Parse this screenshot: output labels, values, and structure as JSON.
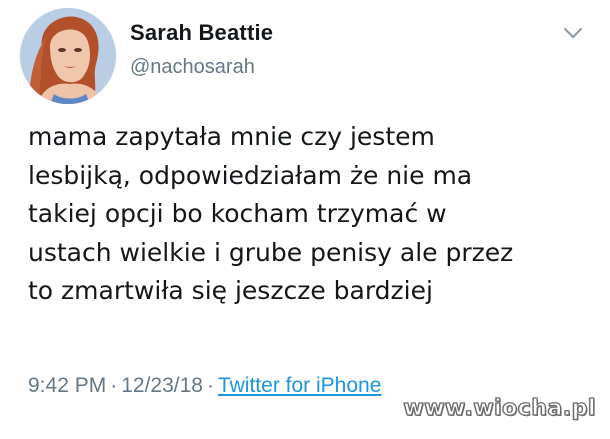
{
  "tweet": {
    "author": {
      "name": "Sarah Beattie",
      "handle": "@nachosarah"
    },
    "text_lines": [
      "mama zapytała mnie czy jestem",
      "lesbijką, odpowiedziałam że nie ma",
      "takiej opcji bo kocham trzymać w",
      "ustach wielkie i grube penisy ale przez",
      "to zmartwiła się jeszcze bardziej"
    ],
    "time": "9:42 PM",
    "separator": "·",
    "date": "12/23/18",
    "source": "Twitter for iPhone"
  },
  "icons": {
    "menu": "chevron-down-icon",
    "avatar": "avatar"
  },
  "watermark": "www.wiocha.pl",
  "colors": {
    "text": "#14171a",
    "secondary": "#657786",
    "link": "#1b95e0",
    "background": "#ffffff"
  }
}
